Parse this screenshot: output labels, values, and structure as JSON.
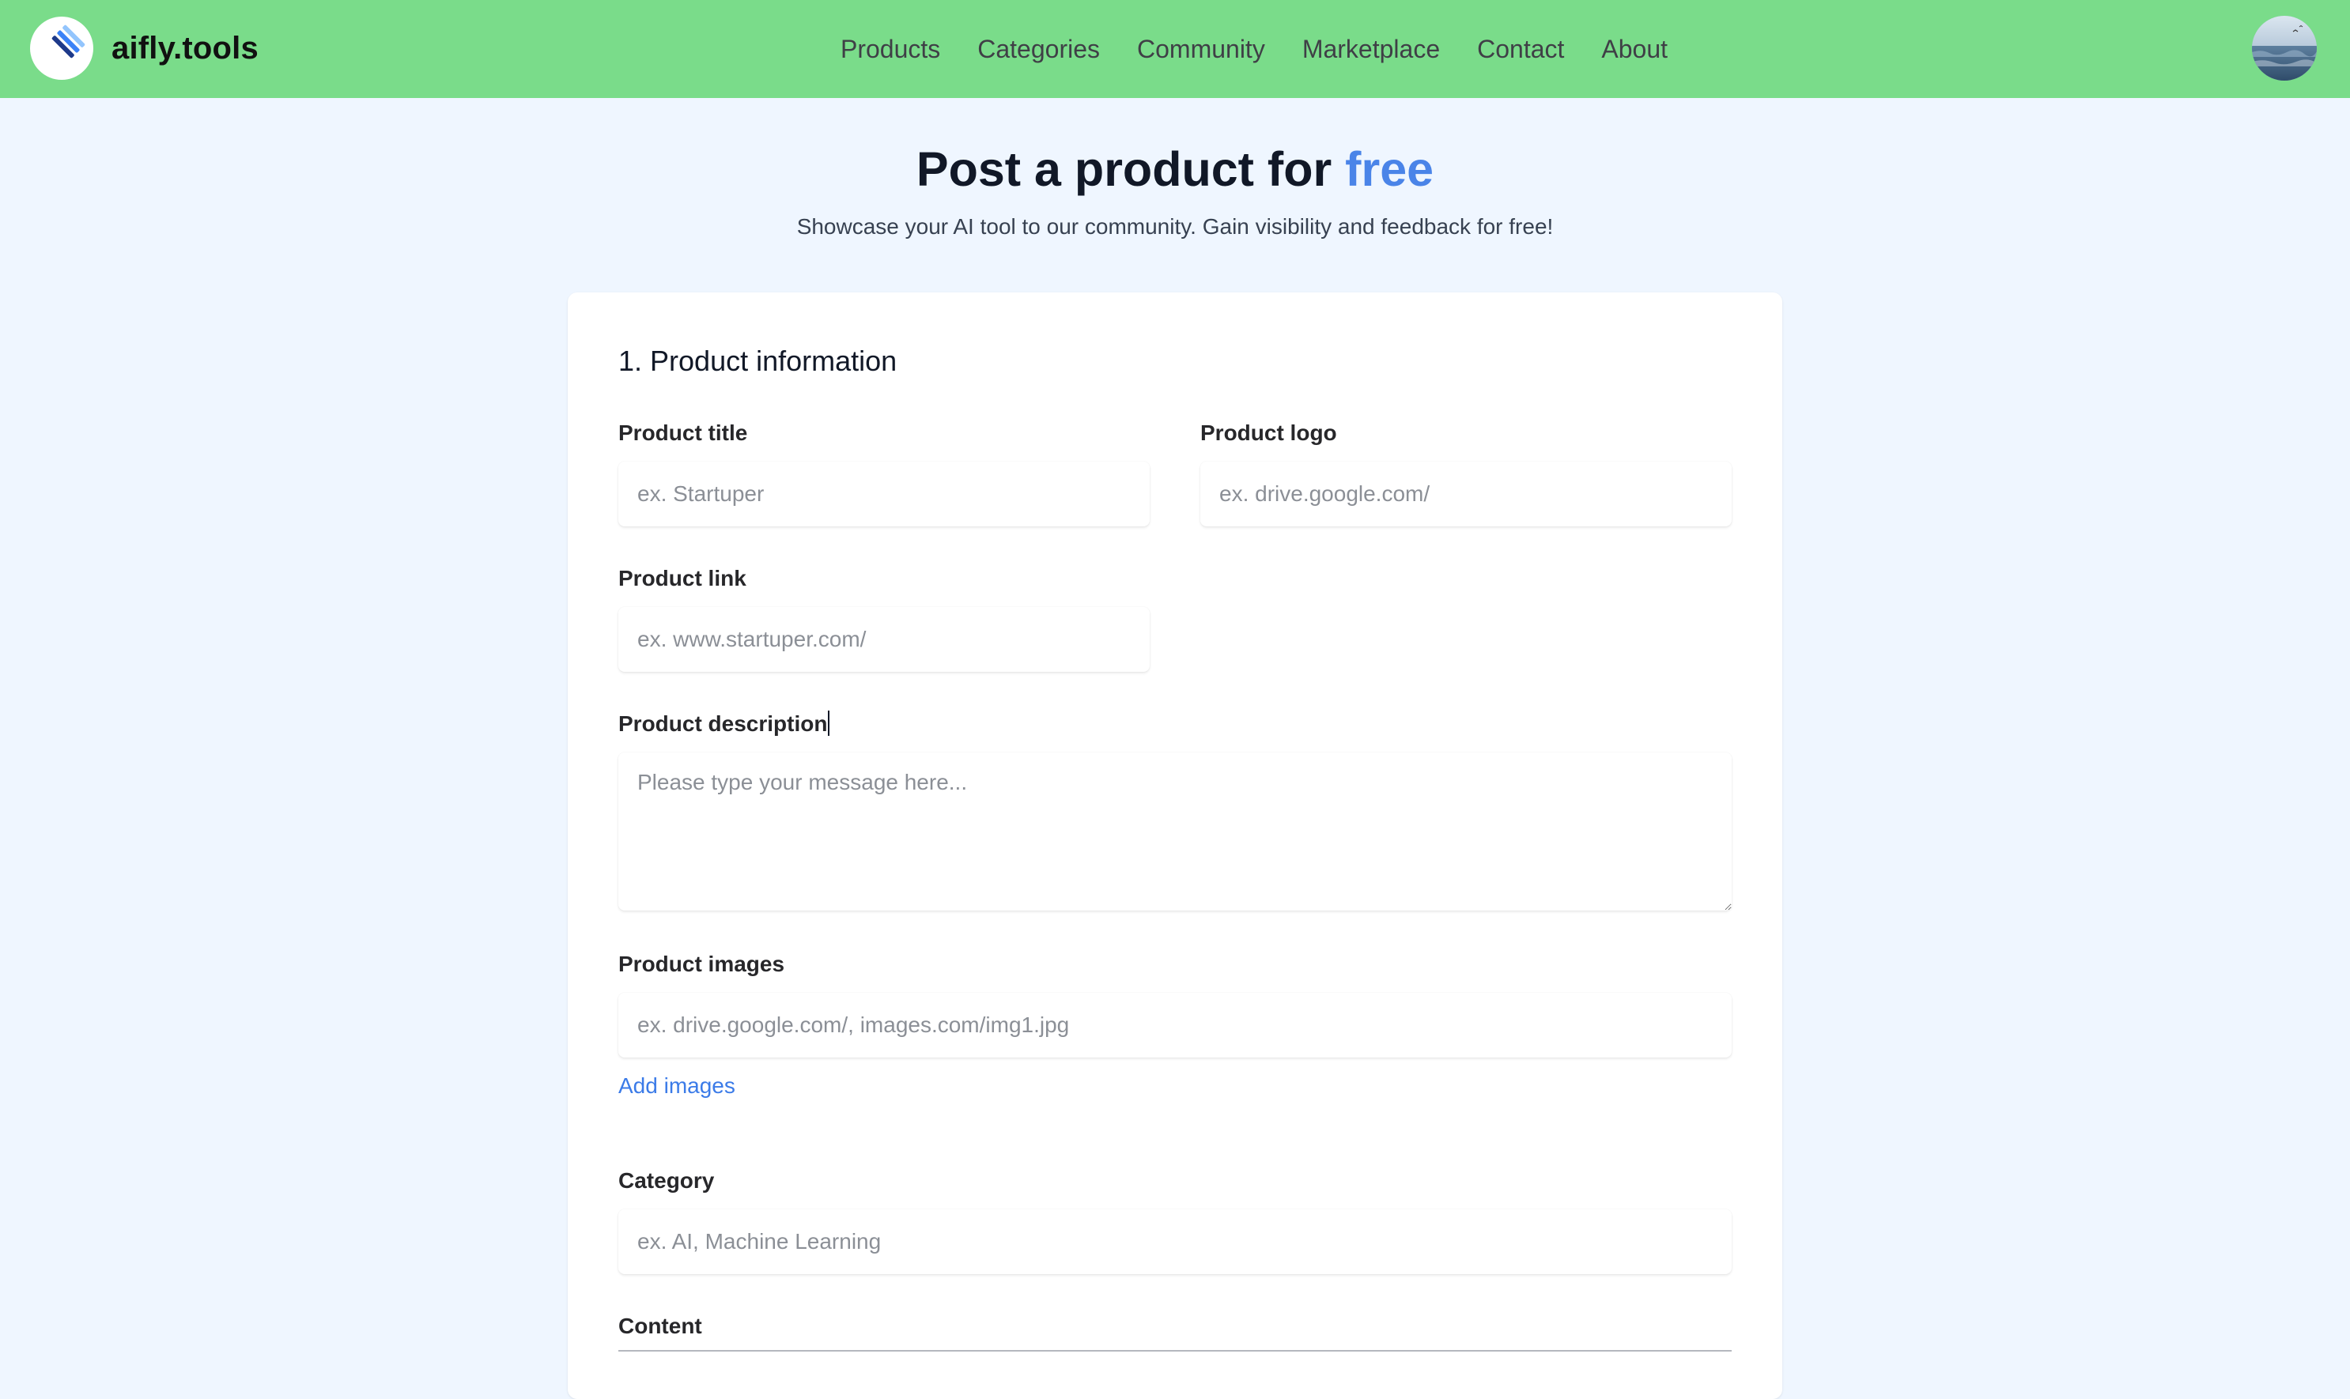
{
  "brand": {
    "name": "aifly.tools"
  },
  "nav": {
    "items": [
      "Products",
      "Categories",
      "Community",
      "Marketplace",
      "Contact",
      "About"
    ]
  },
  "hero": {
    "title_main": "Post a product for ",
    "title_accent": "free",
    "subtitle": "Showcase your AI tool to our community. Gain visibility and feedback for free!"
  },
  "form": {
    "section_title": "1. Product information",
    "product_title": {
      "label": "Product title",
      "placeholder": "ex. Startuper",
      "value": ""
    },
    "product_logo": {
      "label": "Product logo",
      "placeholder": "ex. drive.google.com/",
      "value": ""
    },
    "product_link": {
      "label": "Product link",
      "placeholder": "ex. www.startuper.com/",
      "value": ""
    },
    "product_description": {
      "label": "Product description",
      "placeholder": "Please type your message here...",
      "value": ""
    },
    "product_images": {
      "label": "Product images",
      "placeholder": "ex. drive.google.com/, images.com/img1.jpg",
      "value": "",
      "add_link": "Add images"
    },
    "category": {
      "label": "Category",
      "placeholder": "ex. AI, Machine Learning",
      "value": ""
    },
    "content": {
      "label": "Content"
    }
  },
  "colors": {
    "navbar": "#7adc8a",
    "page_background": "#eff6ff",
    "accent": "#4a84e8",
    "link": "#3b7be8"
  },
  "icons": {
    "brand_logo": "diagonal-stripes-logo-icon",
    "avatar": "user-avatar-photo"
  }
}
